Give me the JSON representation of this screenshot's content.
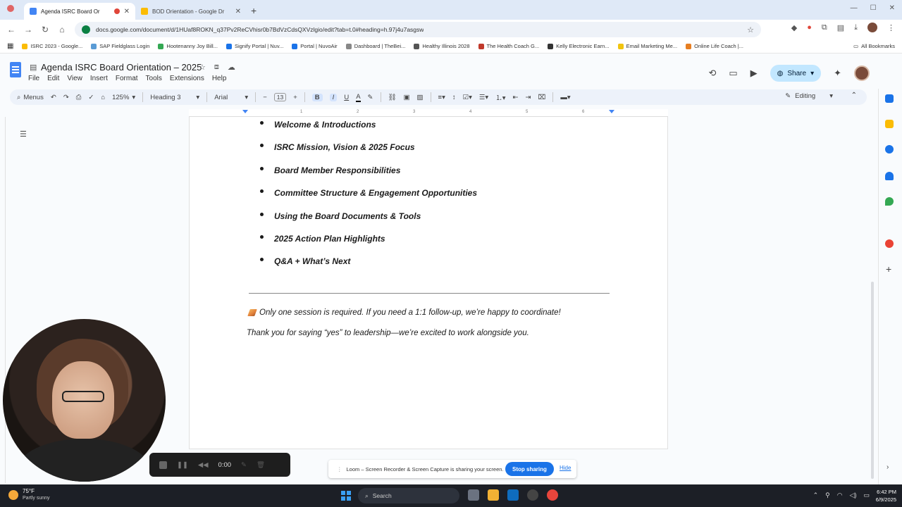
{
  "browser": {
    "tabs": [
      {
        "title": "Agenda ISRC Board Or",
        "active": true
      },
      {
        "title": "BOD Orientation - Google Dr",
        "active": false
      }
    ],
    "url": "docs.google.com/document/d/1HUaf8ROKN_q37Pv2ReCVhisr0b7BdVzCdsQXVzlgio/edit?tab=t.0#heading=h.97j4u7asgsw",
    "bookmarks": [
      {
        "label": "ISRC 2023 - Google...",
        "color": "#fbbc04"
      },
      {
        "label": "SAP Fieldglass Login",
        "color": "#5a9bd5"
      },
      {
        "label": "Hootenanny Joy Bill...",
        "color": "#34a853"
      },
      {
        "label": "Signify Portal | Nuv...",
        "color": "#1a73e8"
      },
      {
        "label": "Portal | NuvoAir",
        "color": "#1a73e8"
      },
      {
        "label": "Dashboard | TheBei...",
        "color": "#888888"
      },
      {
        "label": "Healthy Illinois 2028",
        "color": "#555555"
      },
      {
        "label": "The Health Coach G...",
        "color": "#c0392b"
      },
      {
        "label": "Kelly Electronic Earn...",
        "color": "#333333"
      },
      {
        "label": "Email Marketing Me...",
        "color": "#f1c40f"
      },
      {
        "label": "Online Life Coach |...",
        "color": "#e67e22"
      }
    ],
    "all_bookmarks": "All Bookmarks"
  },
  "docs": {
    "title": "Agenda ISRC Board Orientation – 2025",
    "menu": [
      "File",
      "Edit",
      "View",
      "Insert",
      "Format",
      "Tools",
      "Extensions",
      "Help"
    ],
    "share": "Share",
    "toolbar": {
      "menus": "Menus",
      "zoom": "125%",
      "style": "Heading 3",
      "font": "Arial",
      "font_size": "13",
      "mode": "Editing"
    },
    "ruler_numbers": [
      "1",
      "2",
      "3",
      "4",
      "5",
      "6"
    ]
  },
  "content": {
    "agenda_items": [
      "Welcome & Introductions",
      "ISRC Mission, Vision & 2025 Focus",
      "Board Member Responsibilities",
      "Committee Structure & Engagement Opportunities",
      "Using the Board Documents & Tools",
      "2025 Action Plan Highlights",
      "Q&A + What’s Next"
    ],
    "note": "Only one session is required. If you need a 1:1 follow-up, we’re happy to coordinate!",
    "thanks": "Thank you for saying “yes” to leadership—we’re excited to work alongside you."
  },
  "loom": {
    "timer": "0:00",
    "sharing_text": "Loom – Screen Recorder & Screen Capture is sharing your screen.",
    "stop": "Stop sharing",
    "hide": "Hide"
  },
  "taskbar": {
    "temp": "75°F",
    "condition": "Partly sunny",
    "search": "Search",
    "time": "6:42 PM",
    "date": "6/9/2025"
  }
}
